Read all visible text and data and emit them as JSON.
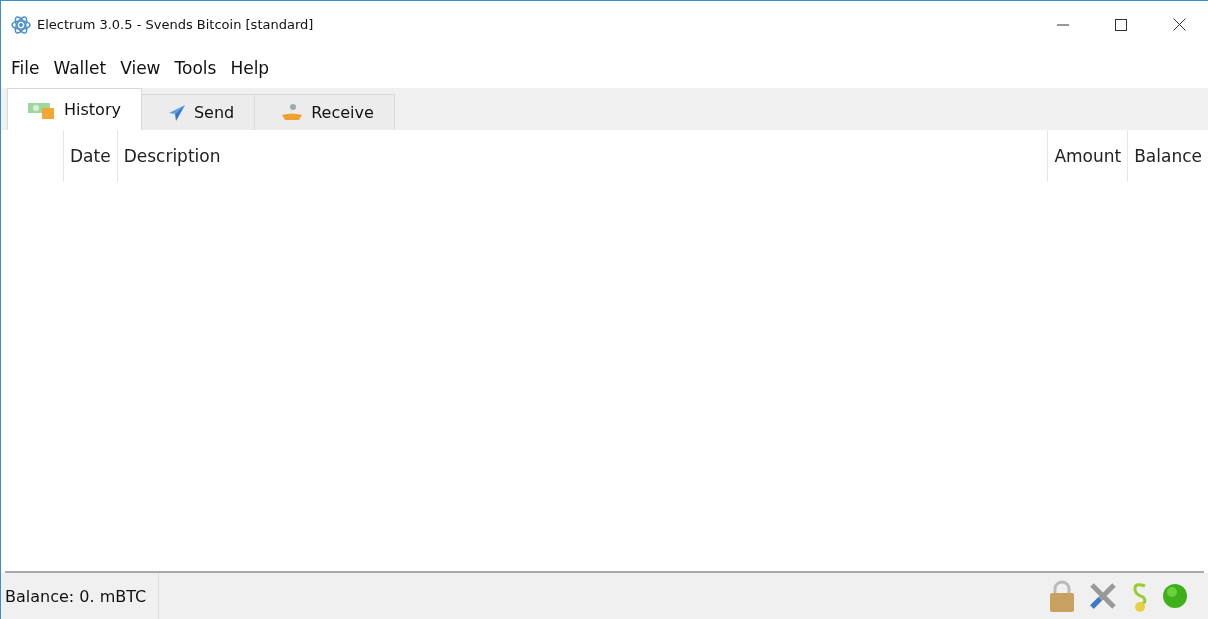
{
  "window": {
    "title": "Electrum 3.0.5  -  Svends Bitcoin  [standard]"
  },
  "menu": [
    "File",
    "Wallet",
    "View",
    "Tools",
    "Help"
  ],
  "tabs": [
    {
      "label": "History",
      "kind": "history",
      "selected": true
    },
    {
      "label": "Send",
      "kind": "send",
      "selected": false
    },
    {
      "label": "Receive",
      "kind": "receive",
      "selected": false
    }
  ],
  "table": {
    "columns": [
      "Date",
      "Description",
      "Amount",
      "Balance"
    ]
  },
  "status_bar": {
    "balance": "Balance: 0. mBTC"
  }
}
